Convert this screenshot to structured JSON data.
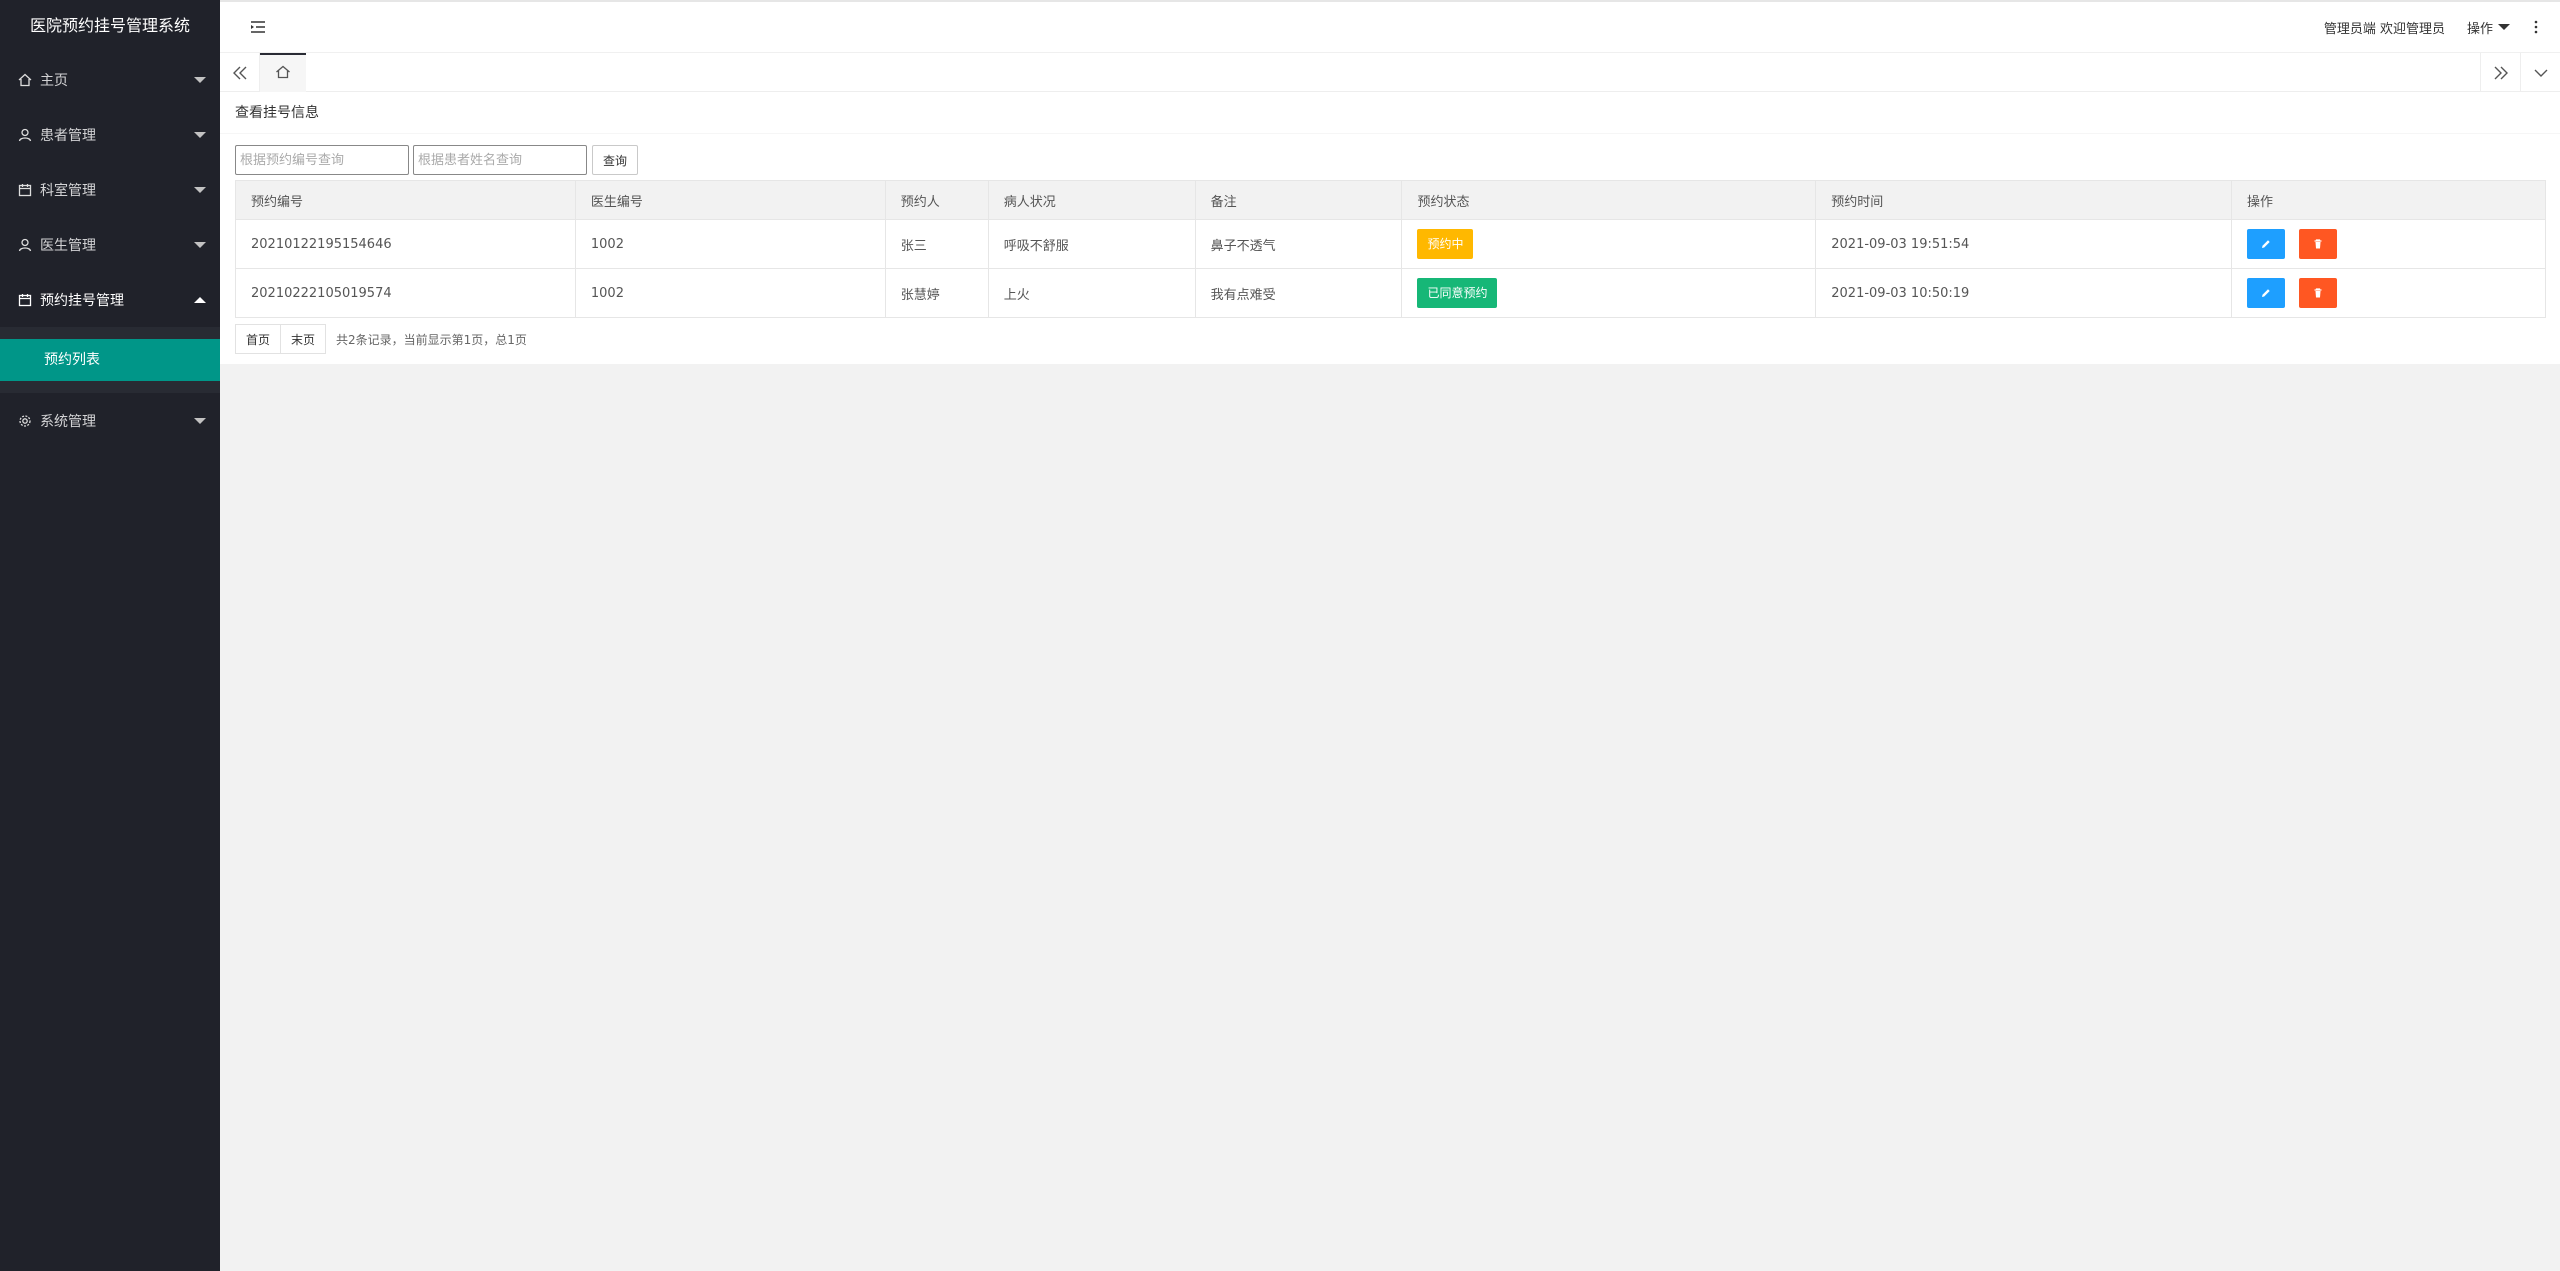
{
  "app": {
    "title": "医院预约挂号管理系统"
  },
  "sidebar": {
    "items": [
      {
        "label": "主页",
        "icon": "home-icon"
      },
      {
        "label": "患者管理",
        "icon": "user-icon"
      },
      {
        "label": "科室管理",
        "icon": "calendar-icon"
      },
      {
        "label": "医生管理",
        "icon": "user-icon"
      },
      {
        "label": "预约挂号管理",
        "icon": "calendar-icon",
        "expanded": true
      },
      {
        "label": "系统管理",
        "icon": "gear-icon"
      }
    ],
    "subitems": [
      {
        "label": "预约列表",
        "active": true
      }
    ]
  },
  "header": {
    "welcome": "管理员端 欢迎管理员",
    "ops_label": "操作"
  },
  "page": {
    "title": "查看挂号信息",
    "search": {
      "id_placeholder": "根据预约编号查询",
      "name_placeholder": "根据患者姓名查询",
      "button_label": "查询"
    },
    "table": {
      "columns": [
        "预约编号",
        "医生编号",
        "预约人",
        "病人状况",
        "备注",
        "预约状态",
        "预约时间",
        "操作"
      ],
      "rows": [
        {
          "id": "20210122195154646",
          "doctor_id": "1002",
          "patient": "张三",
          "condition": "呼吸不舒服",
          "remark": "鼻子不透气",
          "status": "预约中",
          "status_color": "#ffb800",
          "time": "2021-09-03 19:51:54"
        },
        {
          "id": "20210222105019574",
          "doctor_id": "1002",
          "patient": "张慧婷",
          "condition": "上火",
          "remark": "我有点难受",
          "status": "已同意预约",
          "status_color": "#16b777",
          "time": "2021-09-03 10:50:19"
        }
      ]
    },
    "pager": {
      "first_label": "首页",
      "last_label": "末页",
      "info": "共2条记录，当前显示第1页，总1页"
    }
  },
  "colors": {
    "sidebar_bg": "#20222a",
    "active_sub": "#009688",
    "edit_btn": "#1e9fff",
    "delete_btn": "#ff5722"
  }
}
